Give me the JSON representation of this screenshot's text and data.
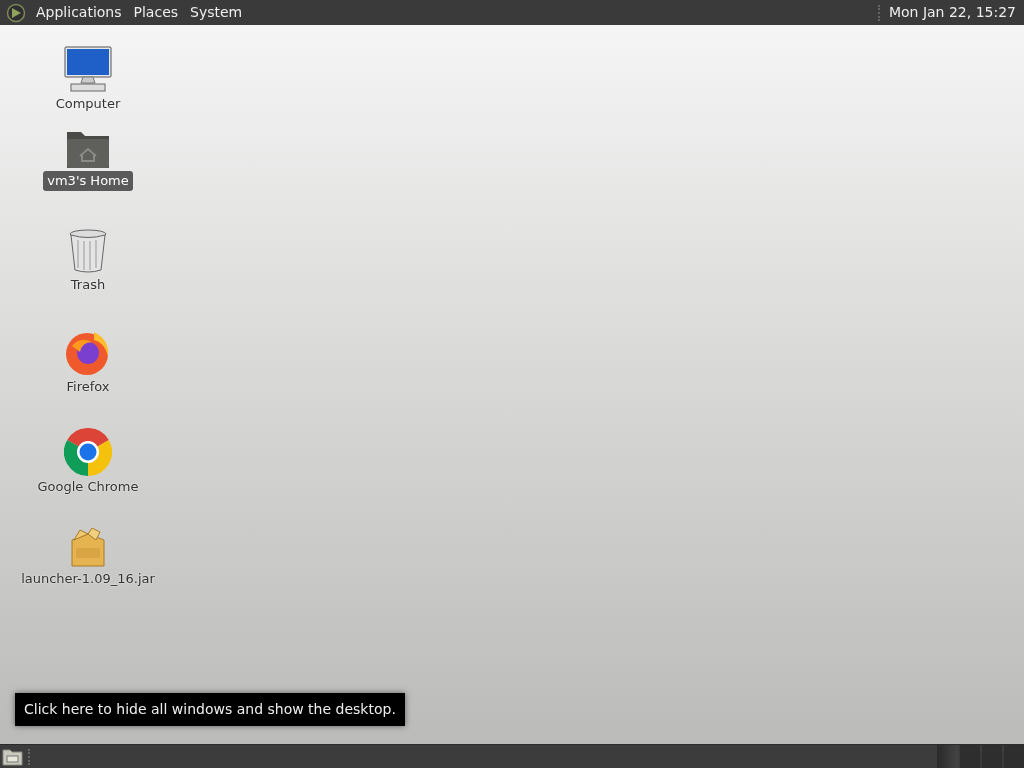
{
  "top_panel": {
    "menus": [
      "Applications",
      "Places",
      "System"
    ],
    "clock": "Mon Jan 22, 15:27"
  },
  "desktop_icons": [
    {
      "kind": "computer",
      "label": "Computer",
      "selected": false
    },
    {
      "kind": "home",
      "label": "vm3's Home",
      "selected": true
    },
    {
      "kind": "trash",
      "label": "Trash",
      "selected": false
    },
    {
      "kind": "firefox",
      "label": "Firefox",
      "selected": false
    },
    {
      "kind": "chrome",
      "label": "Google Chrome",
      "selected": false
    },
    {
      "kind": "package",
      "label": "launcher-1.09_16.jar",
      "selected": false
    }
  ],
  "tooltip": "Click here to hide all windows and show the desktop.",
  "bottom_panel": {
    "workspaces": [
      {
        "selected": true
      },
      {
        "selected": false
      },
      {
        "selected": false
      },
      {
        "selected": false
      }
    ]
  }
}
